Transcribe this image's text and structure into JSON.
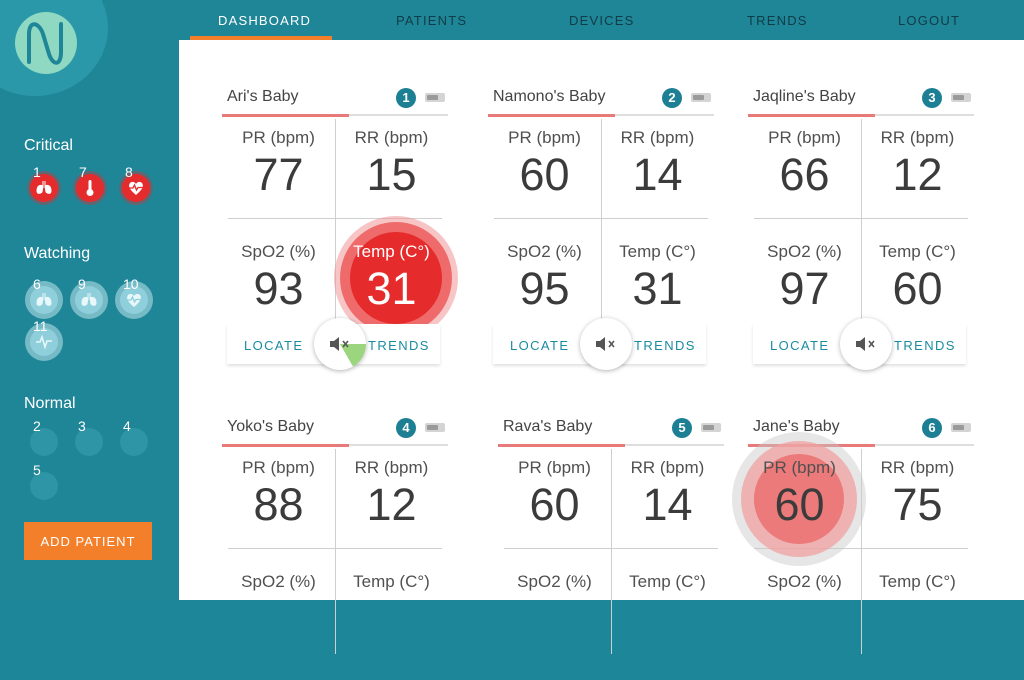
{
  "nav": {
    "items": [
      "DASHBOARD",
      "PATIENTS",
      "DEVICES",
      "TRENDS",
      "LOGOUT"
    ]
  },
  "sidebar": {
    "critical_title": "Critical",
    "watching_title": "Watching",
    "normal_title": "Normal",
    "critical": [
      {
        "num": "1",
        "icon": "lungs-icon"
      },
      {
        "num": "7",
        "icon": "thermometer-icon"
      },
      {
        "num": "8",
        "icon": "heart-pulse-icon"
      }
    ],
    "watching": [
      {
        "num": "6",
        "icon": "lungs-icon"
      },
      {
        "num": "9",
        "icon": "lungs-icon"
      },
      {
        "num": "10",
        "icon": "heart-pulse-icon"
      },
      {
        "num": "11",
        "icon": "pulse-icon"
      }
    ],
    "normal": [
      "2",
      "3",
      "4",
      "5"
    ],
    "add_patient": "ADD PATIENT"
  },
  "cards": [
    {
      "name": "Ari's Baby",
      "badge": "1",
      "pr_label": "PR (bpm)",
      "pr": "77",
      "rr_label": "RR (bpm)",
      "rr": "15",
      "spo2_label": "SpO2 (%)",
      "spo2": "93",
      "temp_label": "Temp (C°)",
      "temp": "31",
      "locate": "LOCATE",
      "trends": "TRENDS",
      "alert": "temp"
    },
    {
      "name": "Namono's Baby",
      "badge": "2",
      "pr_label": "PR (bpm)",
      "pr": "60",
      "rr_label": "RR (bpm)",
      "rr": "14",
      "spo2_label": "SpO2 (%)",
      "spo2": "95",
      "temp_label": "Temp (C°)",
      "temp": "31",
      "locate": "LOCATE",
      "trends": "TRENDS",
      "alert": ""
    },
    {
      "name": "Jaqline's Baby",
      "badge": "3",
      "pr_label": "PR (bpm)",
      "pr": "66",
      "rr_label": "RR (bpm)",
      "rr": "12",
      "spo2_label": "SpO2 (%)",
      "spo2": "97",
      "temp_label": "Temp (C°)",
      "temp": "60",
      "locate": "LOCATE",
      "trends": "TRENDS",
      "alert": ""
    },
    {
      "name": "Yoko's Baby",
      "badge": "4",
      "pr_label": "PR (bpm)",
      "pr": "88",
      "rr_label": "RR (bpm)",
      "rr": "12",
      "spo2_label": "SpO2 (%)",
      "spo2": "",
      "temp_label": "Temp (C°)",
      "temp": "",
      "locate": "",
      "trends": "",
      "alert": ""
    },
    {
      "name": "Rava's Baby",
      "badge": "5",
      "pr_label": "PR (bpm)",
      "pr": "60",
      "rr_label": "RR (bpm)",
      "rr": "14",
      "spo2_label": "SpO2 (%)",
      "spo2": "",
      "temp_label": "Temp (C°)",
      "temp": "",
      "locate": "",
      "trends": "",
      "alert": ""
    },
    {
      "name": "Jane's Baby",
      "badge": "6",
      "pr_label": "PR (bpm)",
      "pr": "60",
      "rr_label": "RR (bpm)",
      "rr": "75",
      "spo2_label": "SpO2 (%)",
      "spo2": "",
      "temp_label": "Temp (C°)",
      "temp": "",
      "locate": "",
      "trends": "",
      "alert": "pr"
    }
  ],
  "colors": {
    "teal": "#1f8698",
    "accent": "#f47f2a",
    "alert_red": "#e52b2b",
    "badge": "#1c7f93",
    "mute_active": "#9bd67e"
  }
}
